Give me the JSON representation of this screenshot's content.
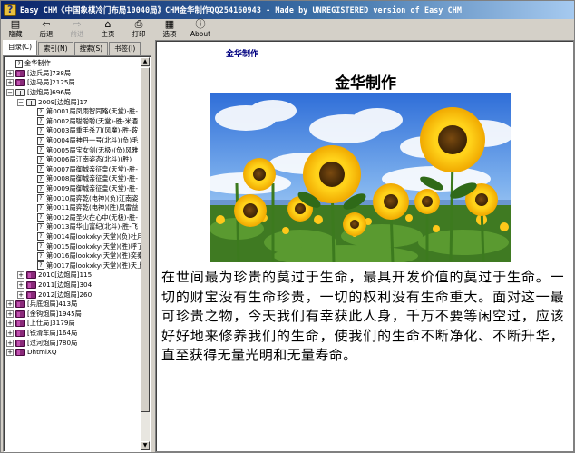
{
  "window": {
    "title": "Easy CHM《中国象棋冷门布局10040局》CHM金华制作QQ254160943 - Made by UNREGISTERED version of Easy CHM"
  },
  "toolbar": {
    "buttons": [
      {
        "label": "隐藏",
        "icon": "hide-pane-icon",
        "glyph": "▤",
        "enabled": true
      },
      {
        "label": "后退",
        "icon": "back-arrow-icon",
        "glyph": "⇦",
        "enabled": true
      },
      {
        "label": "前进",
        "icon": "forward-arrow-icon",
        "glyph": "⇨",
        "enabled": false
      },
      {
        "label": "主页",
        "icon": "home-icon",
        "glyph": "⌂",
        "enabled": true
      },
      {
        "label": "打印",
        "icon": "printer-icon",
        "glyph": "⎙",
        "enabled": true
      },
      {
        "label": "选项",
        "icon": "options-icon",
        "glyph": "▦",
        "enabled": true
      },
      {
        "label": "About",
        "icon": "about-icon",
        "glyph": "ⓘ",
        "enabled": true
      }
    ]
  },
  "tabs": [
    {
      "label": "目录(C)",
      "active": true
    },
    {
      "label": "索引(N)",
      "active": false
    },
    {
      "label": "搜索(S)",
      "active": false
    },
    {
      "label": "书签(I)",
      "active": false
    }
  ],
  "tree": [
    {
      "level": 0,
      "kind": "page",
      "exp": "",
      "text": "金华制作"
    },
    {
      "level": 0,
      "kind": "book",
      "exp": "+",
      "text": "[边兵局]738局"
    },
    {
      "level": 0,
      "kind": "book",
      "exp": "+",
      "text": "[边马局]2125局"
    },
    {
      "level": 0,
      "kind": "book-open",
      "exp": "−",
      "text": "[边炮局]696局"
    },
    {
      "level": 1,
      "kind": "book-open",
      "exp": "−",
      "text": "2009[边炮局]17"
    },
    {
      "level": 2,
      "kind": "page",
      "exp": "",
      "text": "第0001局凤雨智同路(天堂)-胜-"
    },
    {
      "level": 2,
      "kind": "page",
      "exp": "",
      "text": "第0002局聪聪聪(天堂)-胜-米酒"
    },
    {
      "level": 2,
      "kind": "page",
      "exp": "",
      "text": "第0003局重手杀刀(风魔)-胜-鞍"
    },
    {
      "level": 2,
      "kind": "page",
      "exp": "",
      "text": "第0004局神丹一号(北斗)(负)毛"
    },
    {
      "level": 2,
      "kind": "page",
      "exp": "",
      "text": "第0005局宝女剑(无极)(负)风雅"
    },
    {
      "level": 2,
      "kind": "page",
      "exp": "",
      "text": "第0006局江南姿态(北斗)(胜)"
    },
    {
      "level": 2,
      "kind": "page",
      "exp": "",
      "text": "第0007局御城亲征皇(天堂)-胜-"
    },
    {
      "level": 2,
      "kind": "page",
      "exp": "",
      "text": "第0008局御城亲征皇(天堂)-胜-"
    },
    {
      "level": 2,
      "kind": "page",
      "exp": "",
      "text": "第0009局御城亲征皇(天堂)-胜-"
    },
    {
      "level": 2,
      "kind": "page",
      "exp": "",
      "text": "第0010局弈乾(电神)(负)江南姿"
    },
    {
      "level": 2,
      "kind": "page",
      "exp": "",
      "text": "第0011局弈乾(电神)(胜)风雷益"
    },
    {
      "level": 2,
      "kind": "page",
      "exp": "",
      "text": "第0012局圣火在心中(无极)-胜-"
    },
    {
      "level": 2,
      "kind": "page",
      "exp": "",
      "text": "第0013局华山富纪(北斗)-胜-飞"
    },
    {
      "level": 2,
      "kind": "page",
      "exp": "",
      "text": "第0014局lookxky(天堂)(负)杜月"
    },
    {
      "level": 2,
      "kind": "page",
      "exp": "",
      "text": "第0015局lookxky(天堂)(胜)呼了"
    },
    {
      "level": 2,
      "kind": "page",
      "exp": "",
      "text": "第0016局lookxky(天堂)(胜)奕秦"
    },
    {
      "level": 2,
      "kind": "page",
      "exp": "",
      "text": "第0017局lookxky(天堂)(胜)天上"
    },
    {
      "level": 1,
      "kind": "book",
      "exp": "+",
      "text": "2010[边炮局]115"
    },
    {
      "level": 1,
      "kind": "book",
      "exp": "+",
      "text": "2011[边炮局]304"
    },
    {
      "level": 1,
      "kind": "book",
      "exp": "+",
      "text": "2012[边炮局]260"
    },
    {
      "level": 0,
      "kind": "book",
      "exp": "+",
      "text": "[兵底炮局]413局"
    },
    {
      "level": 0,
      "kind": "book",
      "exp": "+",
      "text": "[金钩炮局]1945局"
    },
    {
      "level": 0,
      "kind": "book",
      "exp": "+",
      "text": "[上仕局]3179局"
    },
    {
      "level": 0,
      "kind": "book",
      "exp": "+",
      "text": "[铁滑车局]164局"
    },
    {
      "level": 0,
      "kind": "book",
      "exp": "+",
      "text": "[过河炮局]780局"
    },
    {
      "level": 0,
      "kind": "book",
      "exp": "+",
      "text": "DhtmlXQ"
    }
  ],
  "content": {
    "header_link": "金华制作",
    "title": "金华制作",
    "image_alt": "sunflower-field-photo",
    "paragraph": "在世间最为珍贵的莫过于生命，最具开发价值的莫过于生命。一切的财宝没有生命珍贵，一切的权利没有生命重大。面对这一最可珍贵之物，今天我们有幸获此人身，千万不要等闲空过，应该好好地来修养我们的生命，使我们的生命不断净化、不断升华，直至获得无量光明和无量寿命。"
  },
  "colors": {
    "titlebar_start": "#0a246a",
    "titlebar_end": "#a6caf0",
    "link": "#000080",
    "book": "#8a2a7a"
  }
}
